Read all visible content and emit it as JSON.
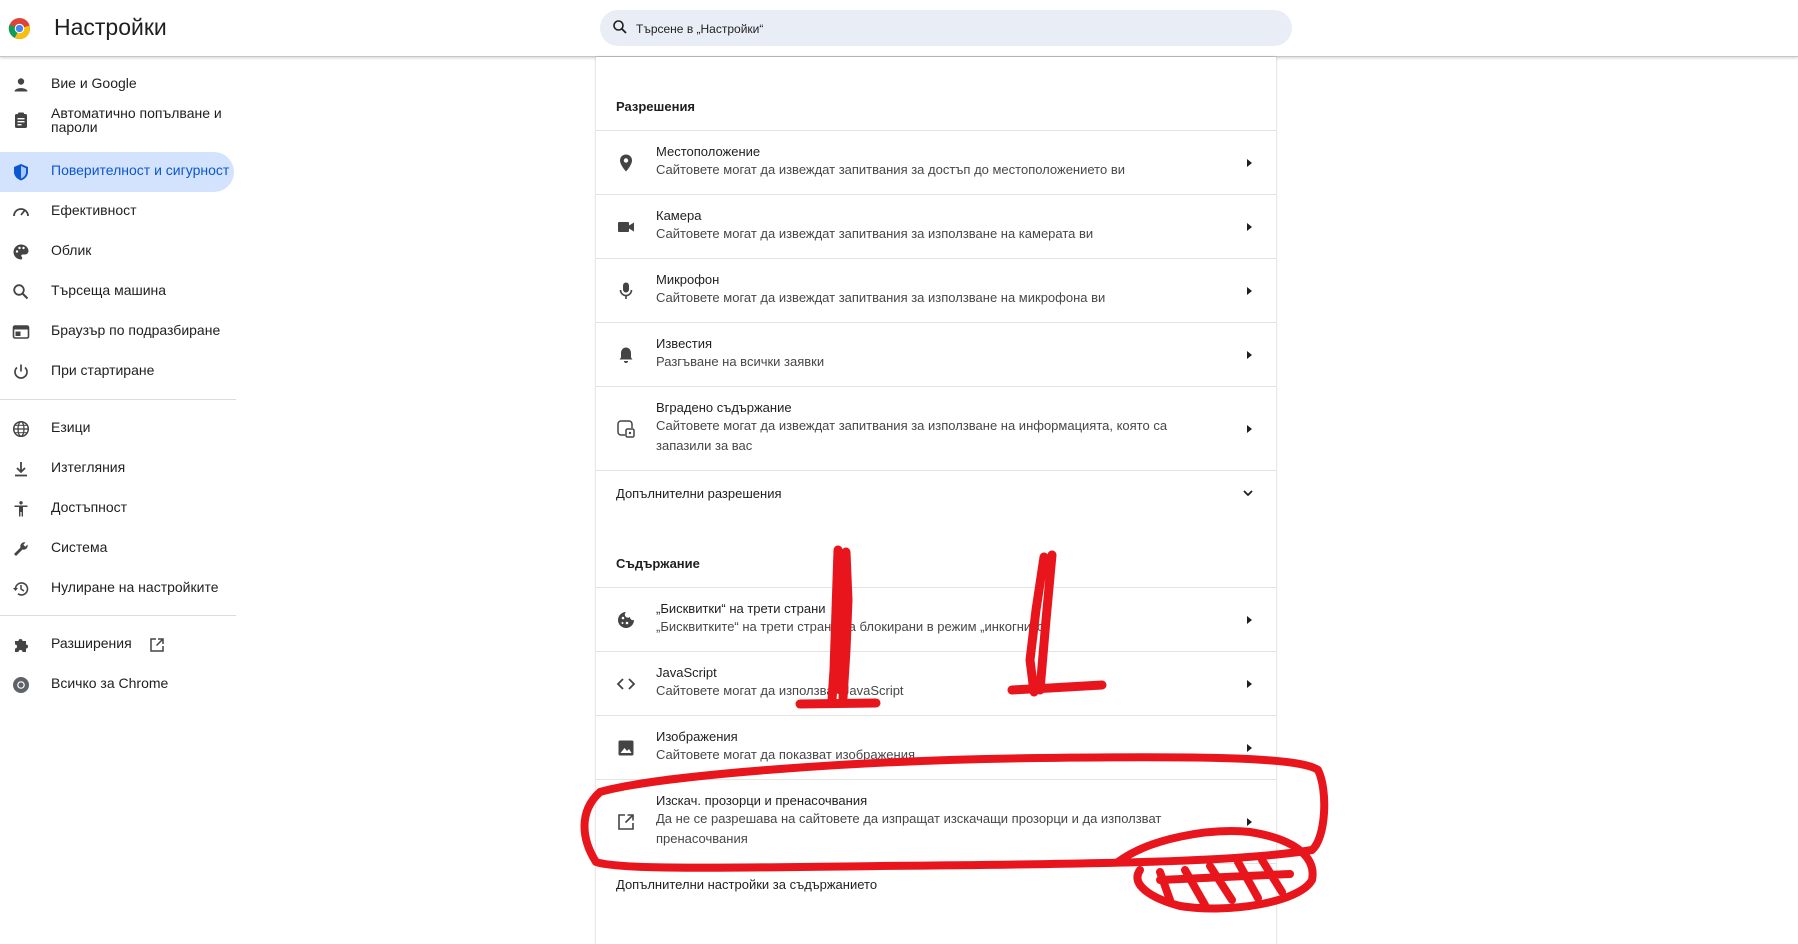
{
  "header": {
    "title": "Настройки",
    "search_placeholder": "Търсене в „Настройки“"
  },
  "sidebar": {
    "items": [
      {
        "label": "Вие и Google",
        "icon": "person-icon"
      },
      {
        "label": "Автоматично попълване и пароли",
        "icon": "clipboard-icon"
      },
      {
        "label": "Поверителност и сигурност",
        "icon": "shield-icon",
        "active": true
      },
      {
        "label": "Ефективност",
        "icon": "speedometer-icon"
      },
      {
        "label": "Облик",
        "icon": "palette-icon"
      },
      {
        "label": "Търсеща машина",
        "icon": "search-icon"
      },
      {
        "label": "Браузър по подразбиране",
        "icon": "browser-icon"
      },
      {
        "label": "При стартиране",
        "icon": "power-icon"
      },
      {
        "label": "Езици",
        "icon": "globe-icon"
      },
      {
        "label": "Изтегляния",
        "icon": "download-icon"
      },
      {
        "label": "Достъпност",
        "icon": "accessibility-icon"
      },
      {
        "label": "Система",
        "icon": "wrench-icon"
      },
      {
        "label": "Нулиране на настройките",
        "icon": "history-icon"
      },
      {
        "label": "Разширения",
        "icon": "puzzle-icon"
      },
      {
        "label": "Всичко за Chrome",
        "icon": "chrome-icon"
      }
    ]
  },
  "permissions": {
    "title": "Разрешения",
    "rows": [
      {
        "title": "Местоположение",
        "subtitle": "Сайтовете могат да извеждат запитвания за достъп до местоположението ви",
        "icon": "location-pin-icon"
      },
      {
        "title": "Камера",
        "subtitle": "Сайтовете могат да извеждат запитвания за използване на камерата ви",
        "icon": "camera-icon"
      },
      {
        "title": "Микрофон",
        "subtitle": "Сайтовете могат да извеждат запитвания за използване на микрофона ви",
        "icon": "microphone-icon"
      },
      {
        "title": "Известия",
        "subtitle": "Разгъване на всички заявки",
        "icon": "bell-icon"
      },
      {
        "title": "Вградено съдържание",
        "subtitle": "Сайтовете могат да извеждат запитвания за използване на информацията, която са запазили за вас",
        "icon": "embedded-content-icon"
      }
    ],
    "more_label": "Допълнителни разрешения"
  },
  "content": {
    "title": "Съдържание",
    "rows": [
      {
        "title": "„Бисквитки“ на трети страни",
        "subtitle": "„Бисквитките“ на трети страни са блокирани в режим „инкогнито“",
        "icon": "cookie-icon"
      },
      {
        "title": "JavaScript",
        "subtitle": "Сайтовете могат да използват JavaScript",
        "icon": "code-icon"
      },
      {
        "title": "Изображения",
        "subtitle": "Сайтовете могат да показват изображения",
        "icon": "image-icon"
      },
      {
        "title": "Изскач. прозорци и пренасочвания",
        "subtitle": "Да не се разрешава на сайтовете да изпращат изскачащи прозорци и да използват пренасочвания",
        "icon": "open-in-new-icon"
      }
    ],
    "more_label": "Допълнителни настройки за съдържанието"
  },
  "colors": {
    "accent": "#0b57d0",
    "active_bg": "#d3e3fd",
    "search_bg": "#e9eef6",
    "annotation": "#e8161c"
  }
}
